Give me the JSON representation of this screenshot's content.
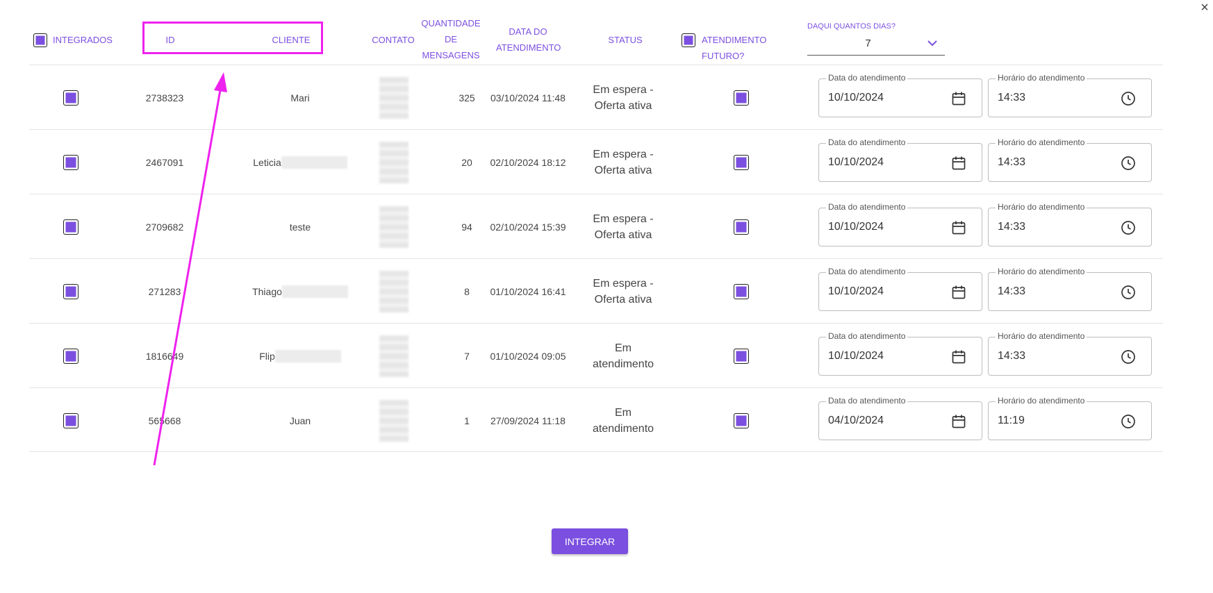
{
  "dialog": {
    "close_label": "×"
  },
  "header": {
    "integrados": "INTEGRADOS",
    "id": "ID",
    "cliente": "CLIENTE",
    "contato": "CONTATO",
    "quantidade": "QUANTIDADE DE MENSAGENS",
    "data": "DATA DO ATENDIMENTO",
    "status": "STATUS",
    "atendimento_futuro": "ATENDIMENTO FUTURO?",
    "dias_label": "DAQUI QUANTOS DIAS?",
    "dias_value": "7"
  },
  "field_labels": {
    "date": "Data do atendimento",
    "time": "Horário do atendimento"
  },
  "rows": [
    {
      "id": "2738323",
      "cliente": "Mari",
      "cliente_redacted": false,
      "mensagens": "325",
      "data": "03/10/2024 11:48",
      "status": "Em espera - Oferta ativa",
      "data_atendimento": "10/10/2024",
      "horario_atendimento": "14:33"
    },
    {
      "id": "2467091",
      "cliente": "Leticia",
      "cliente_redacted": true,
      "mensagens": "20",
      "data": "02/10/2024 18:12",
      "status": "Em espera - Oferta ativa",
      "data_atendimento": "10/10/2024",
      "horario_atendimento": "14:33"
    },
    {
      "id": "2709682",
      "cliente": "teste",
      "cliente_redacted": false,
      "mensagens": "94",
      "data": "02/10/2024 15:39",
      "status": "Em espera - Oferta ativa",
      "data_atendimento": "10/10/2024",
      "horario_atendimento": "14:33"
    },
    {
      "id": "271283",
      "cliente": "Thiago",
      "cliente_redacted": true,
      "mensagens": "8",
      "data": "01/10/2024 16:41",
      "status": "Em espera - Oferta ativa",
      "data_atendimento": "10/10/2024",
      "horario_atendimento": "14:33"
    },
    {
      "id": "1816649",
      "cliente": "Flip",
      "cliente_redacted": true,
      "mensagens": "7",
      "data": "01/10/2024 09:05",
      "status": "Em atendimento",
      "data_atendimento": "10/10/2024",
      "horario_atendimento": "14:33"
    },
    {
      "id": "565668",
      "cliente": "Juan",
      "cliente_redacted": false,
      "mensagens": "1",
      "data": "27/09/2024 11:18",
      "status": "Em atendimento",
      "data_atendimento": "04/10/2024",
      "horario_atendimento": "11:19"
    }
  ],
  "actions": {
    "integrar": "INTEGRAR"
  },
  "colors": {
    "accent": "#7b4fe0",
    "annotation": "#ee22ee"
  },
  "icons": {
    "date": "calendar-icon",
    "time": "clock-icon",
    "dropdown": "chevron-down-icon"
  }
}
